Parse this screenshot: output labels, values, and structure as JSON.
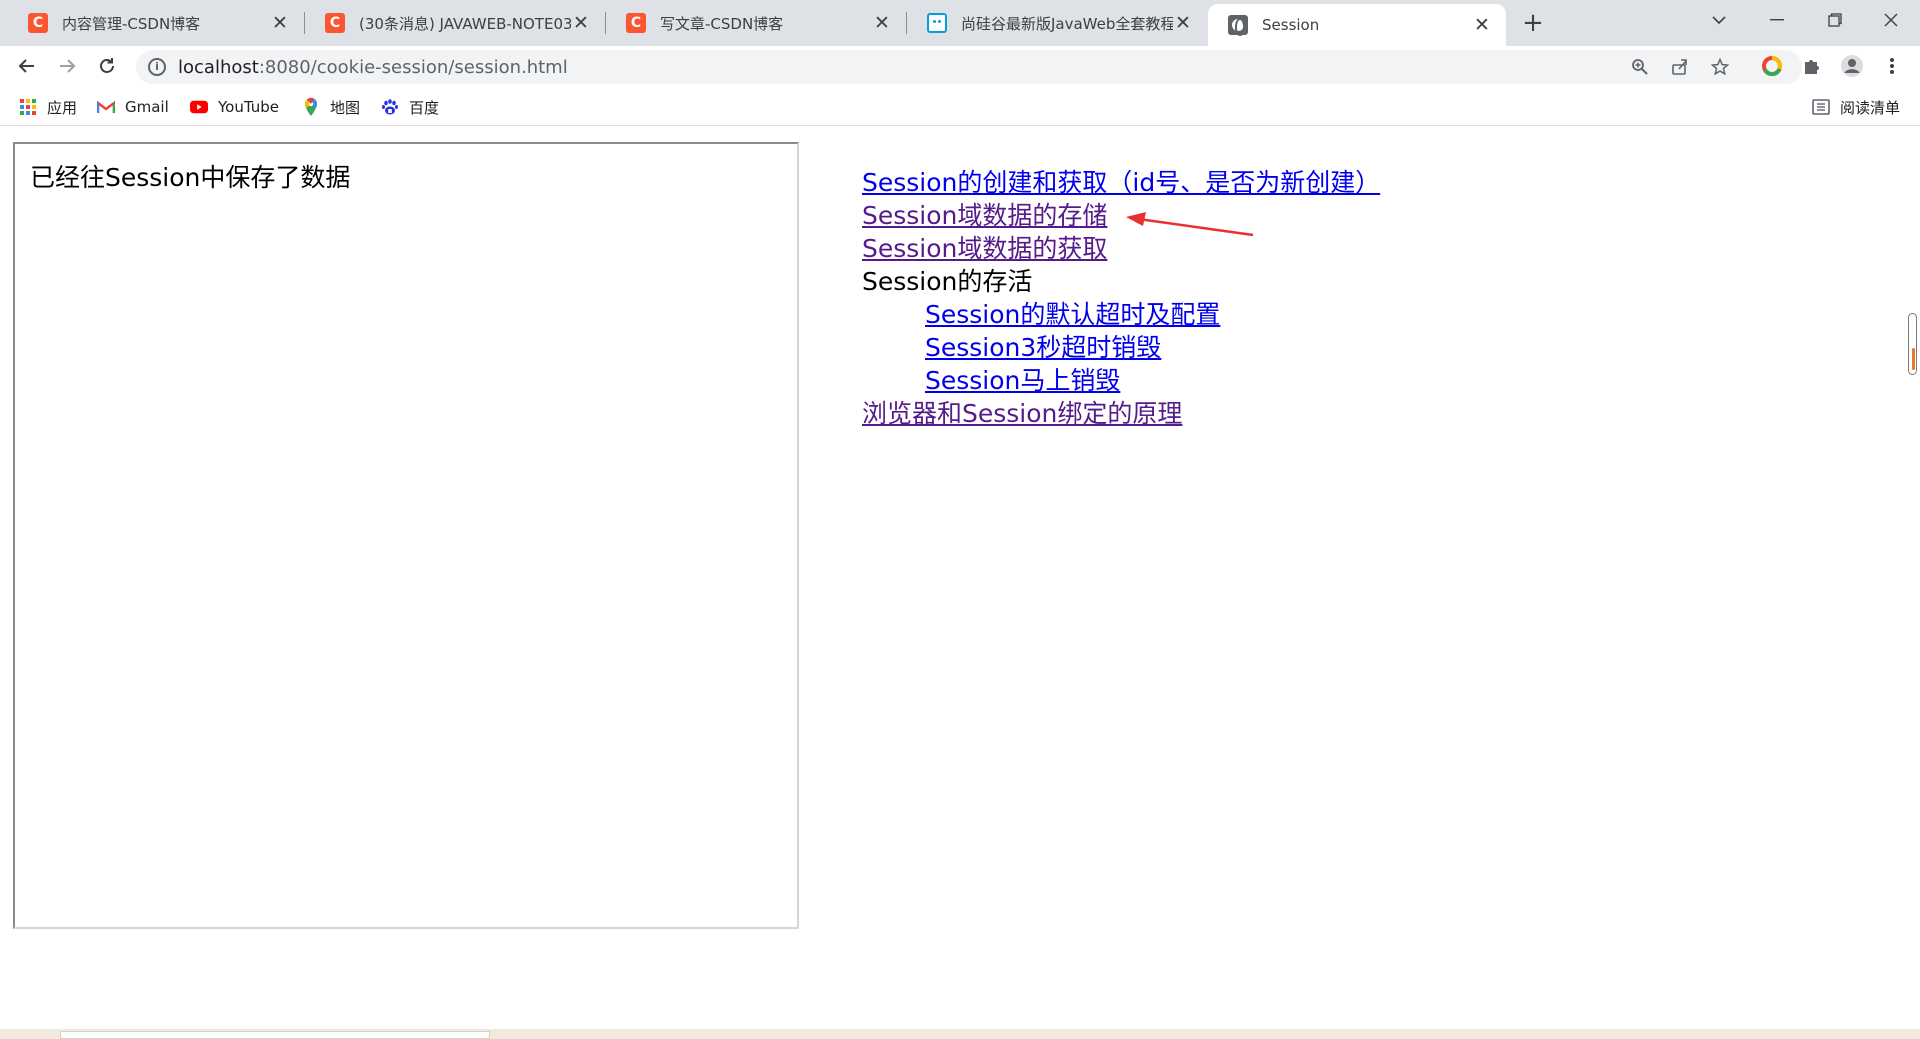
{
  "browser": {
    "tabs": [
      {
        "title": "内容管理-CSDN博客",
        "favicon": "csdn-icon",
        "active": false
      },
      {
        "title": "(30条消息) JAVAWEB-NOTE03_",
        "favicon": "csdn-icon",
        "active": false
      },
      {
        "title": "写文章-CSDN博客",
        "favicon": "csdn-icon",
        "active": false
      },
      {
        "title": "尚硅谷最新版JavaWeb全套教程,",
        "favicon": "bilibili-icon",
        "active": false
      },
      {
        "title": "Session",
        "favicon": "globe-icon",
        "active": true
      }
    ],
    "address": {
      "host": "localhost",
      "path": ":8080/cookie-session/session.html"
    },
    "bookmarks": [
      {
        "label": "应用",
        "icon": "apps-grid-icon"
      },
      {
        "label": "Gmail",
        "icon": "gmail-icon"
      },
      {
        "label": "YouTube",
        "icon": "youtube-icon"
      },
      {
        "label": "地图",
        "icon": "maps-pin-icon"
      },
      {
        "label": "百度",
        "icon": "baidu-paw-icon"
      }
    ],
    "reading_list": "阅读清单"
  },
  "page": {
    "frame_message": "已经往Session中保存了数据",
    "links": [
      {
        "text": "Session的创建和获取（id号、是否为新创建）",
        "visited": false
      },
      {
        "text": "Session域数据的存储",
        "visited": true
      },
      {
        "text": "Session域数据的获取",
        "visited": true
      },
      {
        "text": "Session的存活",
        "plain": true
      },
      {
        "text": "Session的默认超时及配置",
        "visited": false,
        "indent": true
      },
      {
        "text": "Session3秒超时销毁",
        "visited": false,
        "indent": true
      },
      {
        "text": "Session马上销毁",
        "visited": false,
        "indent": true
      },
      {
        "text": "浏览器和Session绑定的原理",
        "visited": true
      }
    ],
    "annotation": {
      "icon": "red-arrow-icon",
      "color": "#e8312f"
    }
  },
  "colors": {
    "link": "#0000ee",
    "visited_link": "#551a8b",
    "csdn_brand": "#fc5531"
  }
}
